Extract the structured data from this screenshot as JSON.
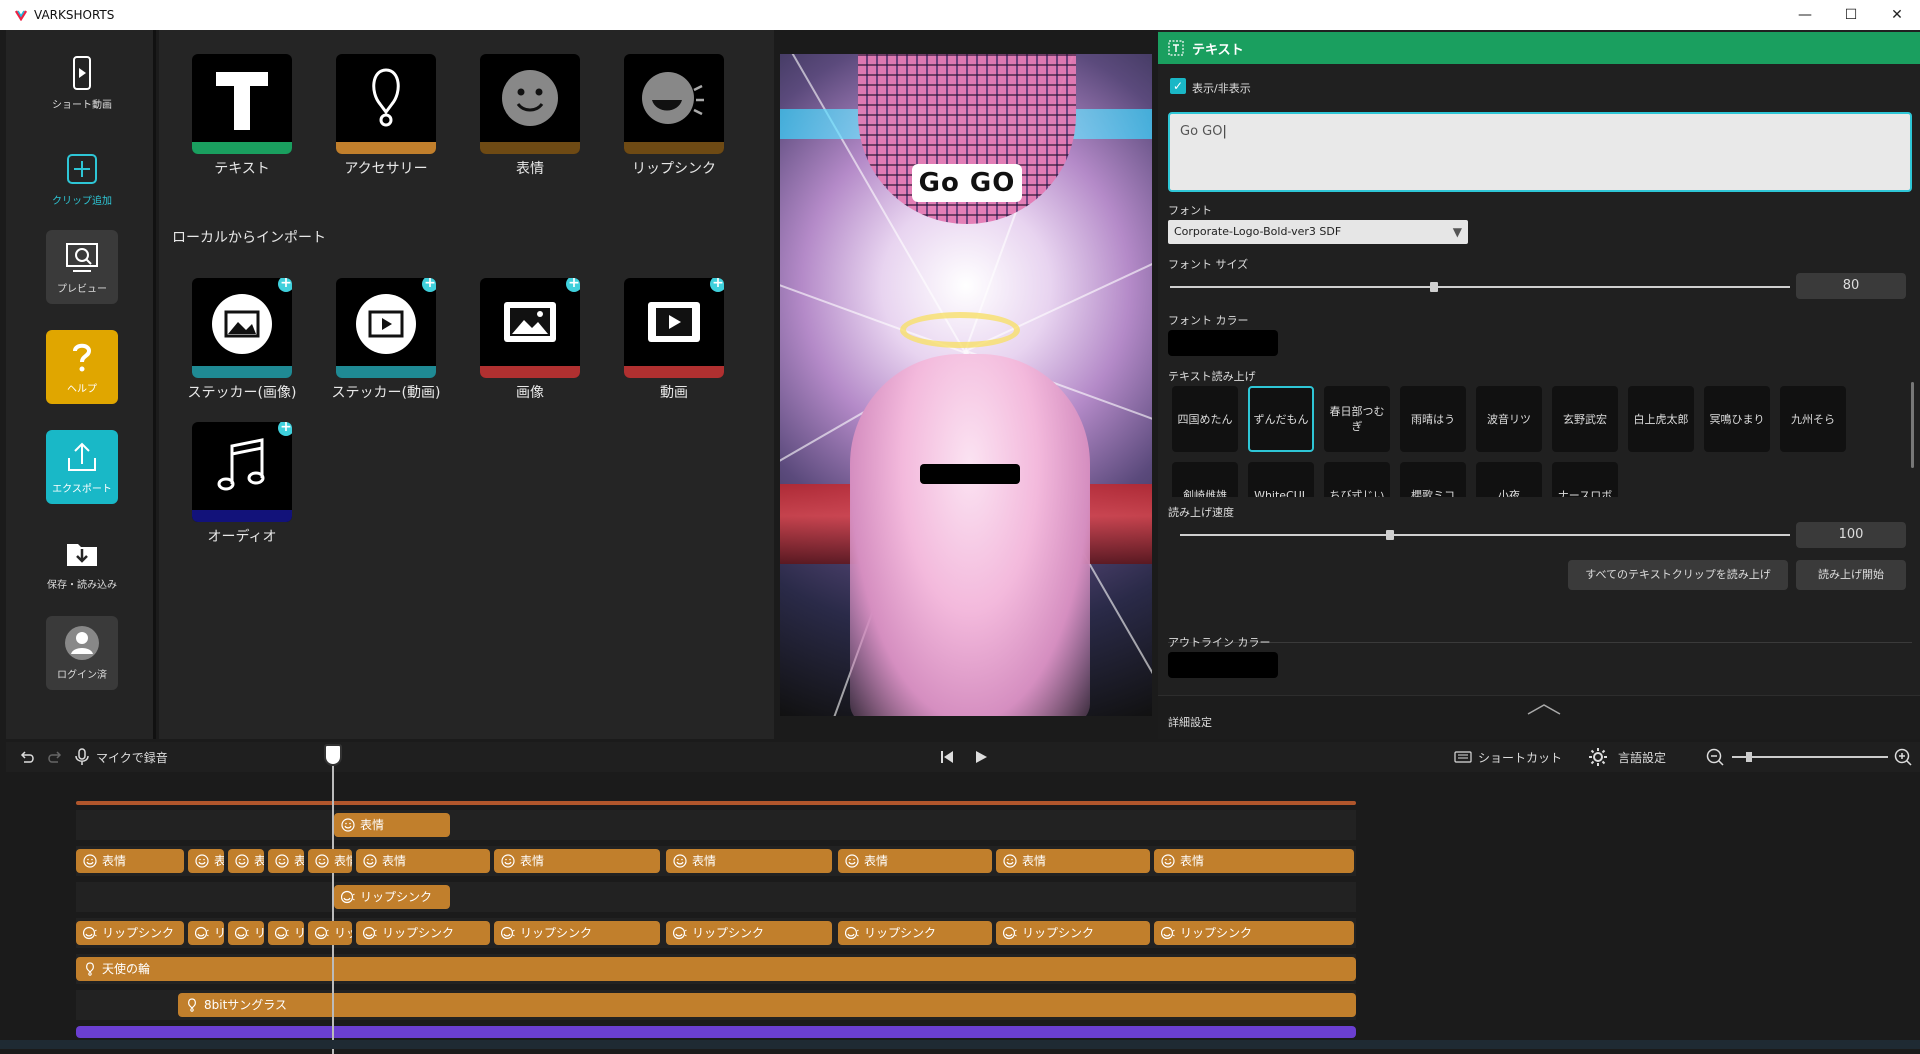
{
  "window": {
    "title": "VARKSHORTS",
    "controls": [
      "—",
      "☐",
      "✕"
    ]
  },
  "nav": {
    "items": [
      {
        "label": "ショート動画"
      },
      {
        "label": "クリップ追加"
      },
      {
        "label": "プレビュー"
      },
      {
        "label": "ヘルプ"
      },
      {
        "label": "エクスポート"
      },
      {
        "label": "保存・読み込み"
      },
      {
        "label": "ログイン済"
      }
    ]
  },
  "library": {
    "tiles": [
      {
        "label": "テキスト",
        "color": "#1a9f5f"
      },
      {
        "label": "アクセサリー",
        "color": "#c17f2c"
      },
      {
        "label": "表情",
        "color": "#6e4a14"
      },
      {
        "label": "リップシンク",
        "color": "#6e4a14"
      }
    ],
    "import_title": "ローカルからインポート",
    "import_tiles": [
      {
        "label": "ステッカー(画像)",
        "color": "#1f8a94"
      },
      {
        "label": "ステッカー(動画)",
        "color": "#1f8a94"
      },
      {
        "label": "画像",
        "color": "#b03030"
      },
      {
        "label": "動画",
        "color": "#b03030"
      },
      {
        "label": "オーディオ",
        "color": "#12127a"
      }
    ]
  },
  "preview": {
    "caption": "Go GO"
  },
  "props": {
    "header": "テキスト",
    "visibility_label": "表示/非表示",
    "text_value": "Go GO",
    "font_label": "フォント",
    "font_value": "Corporate-Logo-Bold-ver3 SDF",
    "font_size_label": "フォント サイズ",
    "font_size_value": "80",
    "font_color_label": "フォント カラー",
    "tts_label": "テキスト読み上げ",
    "voices_row1": [
      "四国めたん",
      "ずんだもん",
      "春日部つむぎ",
      "雨晴はう",
      "波音リツ",
      "玄野武宏",
      "白上虎太郎",
      "冥鳴ひまり",
      "九州そら"
    ],
    "voices_row2": [
      "剣崎雌雄",
      "WhiteCUL",
      "ちび式じい",
      "櫻歌ミコ",
      "小夜",
      "ナースロボ"
    ],
    "selected_voice": "ずんだもん",
    "speed_label": "読み上げ速度",
    "speed_value": "100",
    "read_all_button": "すべてのテキストクリップを読み上げ",
    "read_start_button": "読み上げ開始",
    "outline_color_label": "アウトライン カラー",
    "advanced_label": "詳細設定"
  },
  "toolbar": {
    "mic_label": "マイクで録音",
    "shortcut_label": "ショートカット",
    "language_label": "言語設定"
  },
  "timeline": {
    "face_label": "表情",
    "lip_label": "リップシンク",
    "halo_label": "天使の輪",
    "glasses_label": "8bitサングラス"
  }
}
